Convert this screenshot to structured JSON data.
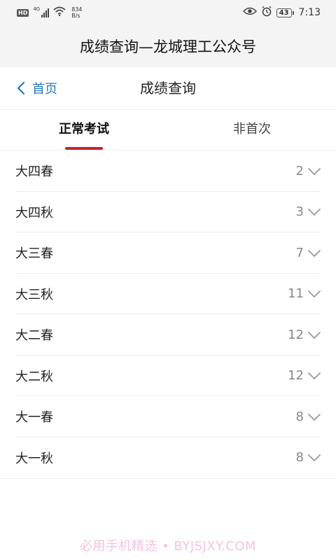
{
  "status_bar": {
    "hd_label": "HD",
    "network_gen": "4G",
    "speed_value": "834",
    "speed_unit": "B/s",
    "battery_level": "43",
    "time": "7:13",
    "icons": [
      "signal-icon",
      "wifi-icon",
      "eye-icon",
      "alarm-icon",
      "battery-icon"
    ]
  },
  "app_title": "成绩查询—龙城理工公众号",
  "nav": {
    "back_label": "首页",
    "title": "成绩查询"
  },
  "tabs": [
    {
      "label": "正常考试",
      "active": true
    },
    {
      "label": "非首次",
      "active": false
    }
  ],
  "semesters": [
    {
      "label": "大四春",
      "count": "2"
    },
    {
      "label": "大四秋",
      "count": "3"
    },
    {
      "label": "大三春",
      "count": "7"
    },
    {
      "label": "大三秋",
      "count": "11"
    },
    {
      "label": "大二春",
      "count": "12"
    },
    {
      "label": "大二秋",
      "count": "12"
    },
    {
      "label": "大一春",
      "count": "8"
    },
    {
      "label": "大一秋",
      "count": "8"
    }
  ],
  "watermark": "必用手机精选 • BYJSJXY.COM",
  "colors": {
    "accent_blue": "#1f78c8",
    "tab_indicator_red": "#c8232c",
    "header_bg": "#f4f4f4"
  }
}
